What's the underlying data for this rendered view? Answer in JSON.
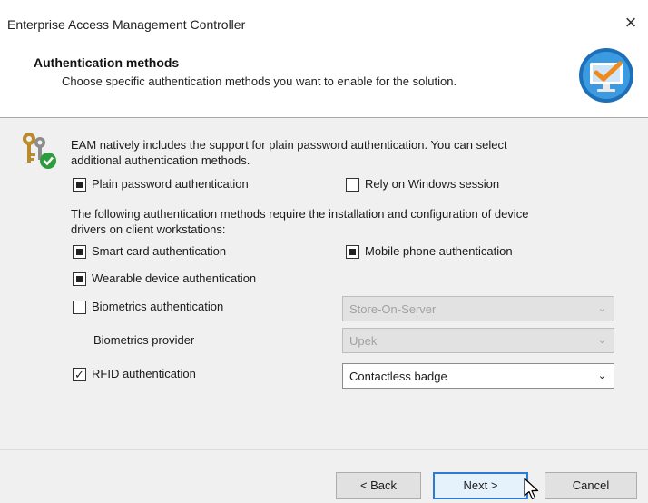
{
  "window": {
    "title": "Enterprise Access Management Controller",
    "close_glyph": "×"
  },
  "header": {
    "title": "Authentication methods",
    "subtitle": "Choose specific authentication methods you want to enable for the solution.",
    "logo_icon": "monitor-check-icon"
  },
  "content": {
    "intro": [
      "EAM natively includes the support for plain password authentication. You can select",
      "additional authentication methods."
    ],
    "device_note": [
      "The following authentication methods require the installation and configuration of device",
      "drivers on client workstations:"
    ],
    "options": {
      "plain_password": {
        "label": "Plain password authentication",
        "state": "indeterminate"
      },
      "windows_session": {
        "label": "Rely on Windows session",
        "state": "unchecked"
      },
      "smart_card": {
        "label": "Smart card authentication",
        "state": "indeterminate"
      },
      "mobile_phone": {
        "label": "Mobile phone authentication",
        "state": "indeterminate"
      },
      "wearable": {
        "label": "Wearable device authentication",
        "state": "indeterminate"
      },
      "biometrics": {
        "label": "Biometrics authentication",
        "state": "unchecked"
      },
      "rfid": {
        "label": "RFID authentication",
        "state": "checked",
        "check_glyph": "✓"
      }
    },
    "biometrics_provider_label": "Biometrics provider",
    "selects": {
      "biometrics_storage": {
        "value": "Store-On-Server",
        "enabled": false
      },
      "biometrics_provider": {
        "value": "Upek",
        "enabled": false
      },
      "rfid_type": {
        "value": "Contactless badge",
        "enabled": true
      }
    },
    "dropdown_glyph": "⌄"
  },
  "footer": {
    "back_label": "< Back",
    "next_label": "Next >",
    "cancel_label": "Cancel"
  },
  "colors": {
    "accent": "#2c7ad6",
    "logo_ring": "#1d6fb8",
    "logo_check": "#f08a1c"
  }
}
